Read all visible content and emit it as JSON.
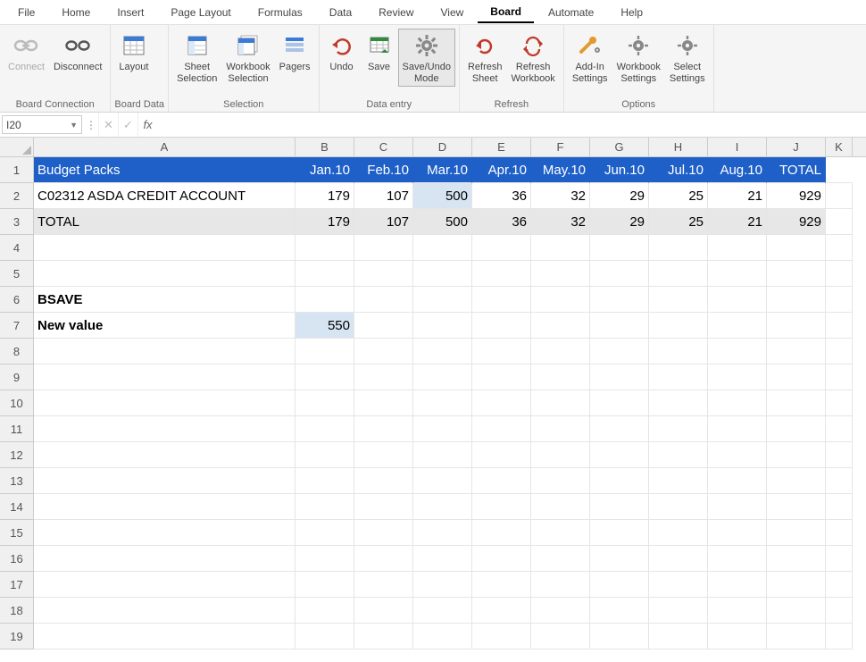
{
  "menu": {
    "items": [
      "File",
      "Home",
      "Insert",
      "Page Layout",
      "Formulas",
      "Data",
      "Review",
      "View",
      "Board",
      "Automate",
      "Help"
    ],
    "active": "Board"
  },
  "ribbon": {
    "groups": [
      {
        "label": "Board Connection",
        "buttons": [
          {
            "name": "connect-button",
            "label": "Connect",
            "icon": "link",
            "disabled": true
          },
          {
            "name": "disconnect-button",
            "label": "Disconnect",
            "icon": "unlink",
            "disabled": false
          }
        ]
      },
      {
        "label": "Board Data",
        "buttons": [
          {
            "name": "layout-button",
            "label": "Layout",
            "icon": "layout"
          }
        ]
      },
      {
        "label": "Selection",
        "buttons": [
          {
            "name": "sheet-selection-button",
            "label": "Sheet\nSelection",
            "icon": "sheetsel"
          },
          {
            "name": "workbook-selection-button",
            "label": "Workbook\nSelection",
            "icon": "wbsel"
          },
          {
            "name": "pagers-button",
            "label": "Pagers",
            "icon": "pagers"
          }
        ]
      },
      {
        "label": "Data entry",
        "buttons": [
          {
            "name": "undo-button",
            "label": "Undo",
            "icon": "undo"
          },
          {
            "name": "save-button",
            "label": "Save",
            "icon": "save"
          },
          {
            "name": "save-undo-mode-button",
            "label": "Save/Undo\nMode",
            "icon": "gear",
            "pressed": true
          }
        ]
      },
      {
        "label": "Refresh",
        "buttons": [
          {
            "name": "refresh-sheet-button",
            "label": "Refresh\nSheet",
            "icon": "refresh1"
          },
          {
            "name": "refresh-workbook-button",
            "label": "Refresh\nWorkbook",
            "icon": "refresh2"
          }
        ]
      },
      {
        "label": "Options",
        "buttons": [
          {
            "name": "addin-settings-button",
            "label": "Add-In\nSettings",
            "icon": "gear-tool"
          },
          {
            "name": "workbook-settings-button",
            "label": "Workbook\nSettings",
            "icon": "gear2"
          },
          {
            "name": "select-settings-button",
            "label": "Select\nSettings",
            "icon": "gear3"
          }
        ]
      }
    ]
  },
  "formula_bar": {
    "name_box": "I20",
    "fx_label": "fx",
    "value": ""
  },
  "grid": {
    "col_letters": [
      "A",
      "B",
      "C",
      "D",
      "E",
      "F",
      "G",
      "H",
      "I",
      "J",
      "K"
    ],
    "row_numbers": [
      "1",
      "2",
      "3",
      "4",
      "5",
      "6",
      "7",
      "8",
      "9",
      "10",
      "11",
      "12",
      "13",
      "14",
      "15",
      "16",
      "17",
      "18",
      "19"
    ],
    "header_row": [
      "Budget Packs",
      "Jan.10",
      "Feb.10",
      "Mar.10",
      "Apr.10",
      "May.10",
      "Jun.10",
      "Jul.10",
      "Aug.10",
      "TOTAL"
    ],
    "data_row": {
      "label": "C02312 ASDA CREDIT ACCOUNT",
      "values": [
        "179",
        "107",
        "500",
        "36",
        "32",
        "29",
        "25",
        "21",
        "929"
      ]
    },
    "total_row": {
      "label": "TOTAL",
      "values": [
        "179",
        "107",
        "500",
        "36",
        "32",
        "29",
        "25",
        "21",
        "929"
      ]
    },
    "bsave_label": "BSAVE",
    "newvalue_label": "New value",
    "newvalue_value": "550"
  },
  "chart_data": {
    "type": "table",
    "title": "Budget Packs",
    "columns": [
      "Jan.10",
      "Feb.10",
      "Mar.10",
      "Apr.10",
      "May.10",
      "Jun.10",
      "Jul.10",
      "Aug.10",
      "TOTAL"
    ],
    "rows": [
      {
        "label": "C02312 ASDA CREDIT ACCOUNT",
        "values": [
          179,
          107,
          500,
          36,
          32,
          29,
          25,
          21,
          929
        ]
      },
      {
        "label": "TOTAL",
        "values": [
          179,
          107,
          500,
          36,
          32,
          29,
          25,
          21,
          929
        ]
      }
    ],
    "annotations": {
      "BSAVE New value": 550
    }
  }
}
